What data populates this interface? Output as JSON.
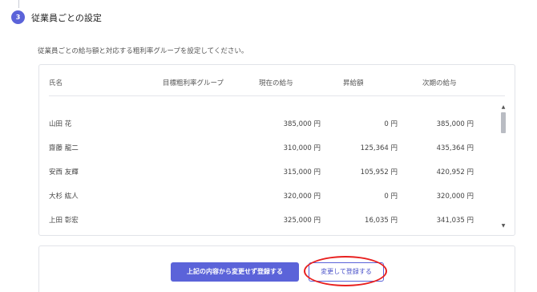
{
  "step": {
    "number": "3",
    "title": "従業員ごとの設定"
  },
  "description": "従業員ごとの給与額と対応する粗利率グループを設定してください。",
  "table": {
    "columns": {
      "name": "氏名",
      "group": "目標粗利率グループ",
      "current": "現在の給与",
      "raise": "昇給額",
      "next": "次期の給与"
    },
    "rows": [
      {
        "name": "山田 花",
        "current": "385,000 円",
        "raise": "0 円",
        "next": "385,000 円"
      },
      {
        "name": "齋藤 龍二",
        "current": "310,000 円",
        "raise": "125,364 円",
        "next": "435,364 円"
      },
      {
        "name": "安西 友輝",
        "current": "315,000 円",
        "raise": "105,952 円",
        "next": "420,952 円"
      },
      {
        "name": "大杉 紘人",
        "current": "320,000 円",
        "raise": "0 円",
        "next": "320,000 円"
      },
      {
        "name": "上田 彰宏",
        "current": "325,000 円",
        "raise": "16,035 円",
        "next": "341,035 円"
      }
    ]
  },
  "actions": {
    "register_without_change": "上記の内容から変更せず登録する",
    "register_with_change": "変更して登録する"
  },
  "colors": {
    "accent": "#5b63d9",
    "annotation": "#e8201f"
  }
}
